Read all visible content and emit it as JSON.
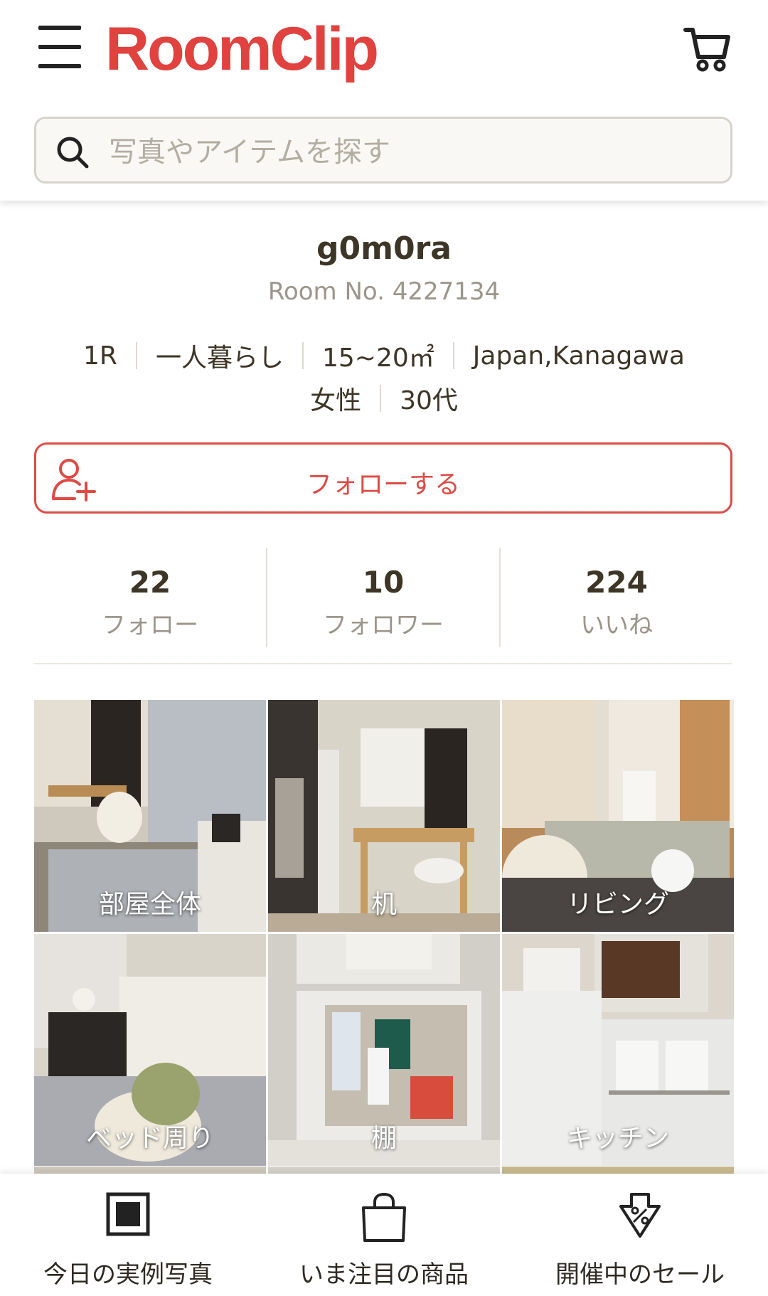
{
  "header": {
    "logo_text": "RoomClip",
    "search_placeholder": "写真やアイテムを探す"
  },
  "profile": {
    "username": "g0m0ra",
    "room_no": "Room No. 4227134",
    "attributes_row1": [
      "1R",
      "一人暮らし",
      "15~20㎡",
      "Japan,Kanagawa"
    ],
    "attributes_row2": [
      "女性",
      "30代"
    ],
    "follow_label": "フォローする"
  },
  "stats": [
    {
      "value": "22",
      "label": "フォロー"
    },
    {
      "value": "10",
      "label": "フォロワー"
    },
    {
      "value": "224",
      "label": "いいね"
    }
  ],
  "tags": [
    {
      "label": "部屋全体"
    },
    {
      "label": "机"
    },
    {
      "label": "リビング"
    },
    {
      "label": "ベッド周り"
    },
    {
      "label": "棚"
    },
    {
      "label": "キッチン"
    }
  ],
  "tabbar": [
    {
      "label": "今日の実例写真",
      "icon": "photo-frame-icon"
    },
    {
      "label": "いま注目の商品",
      "icon": "shopping-bag-icon"
    },
    {
      "label": "開催中のセール",
      "icon": "sale-tag-icon"
    }
  ],
  "colors": {
    "brand": "#e0423f",
    "text": "#3d3526",
    "muted": "#9c958a"
  }
}
